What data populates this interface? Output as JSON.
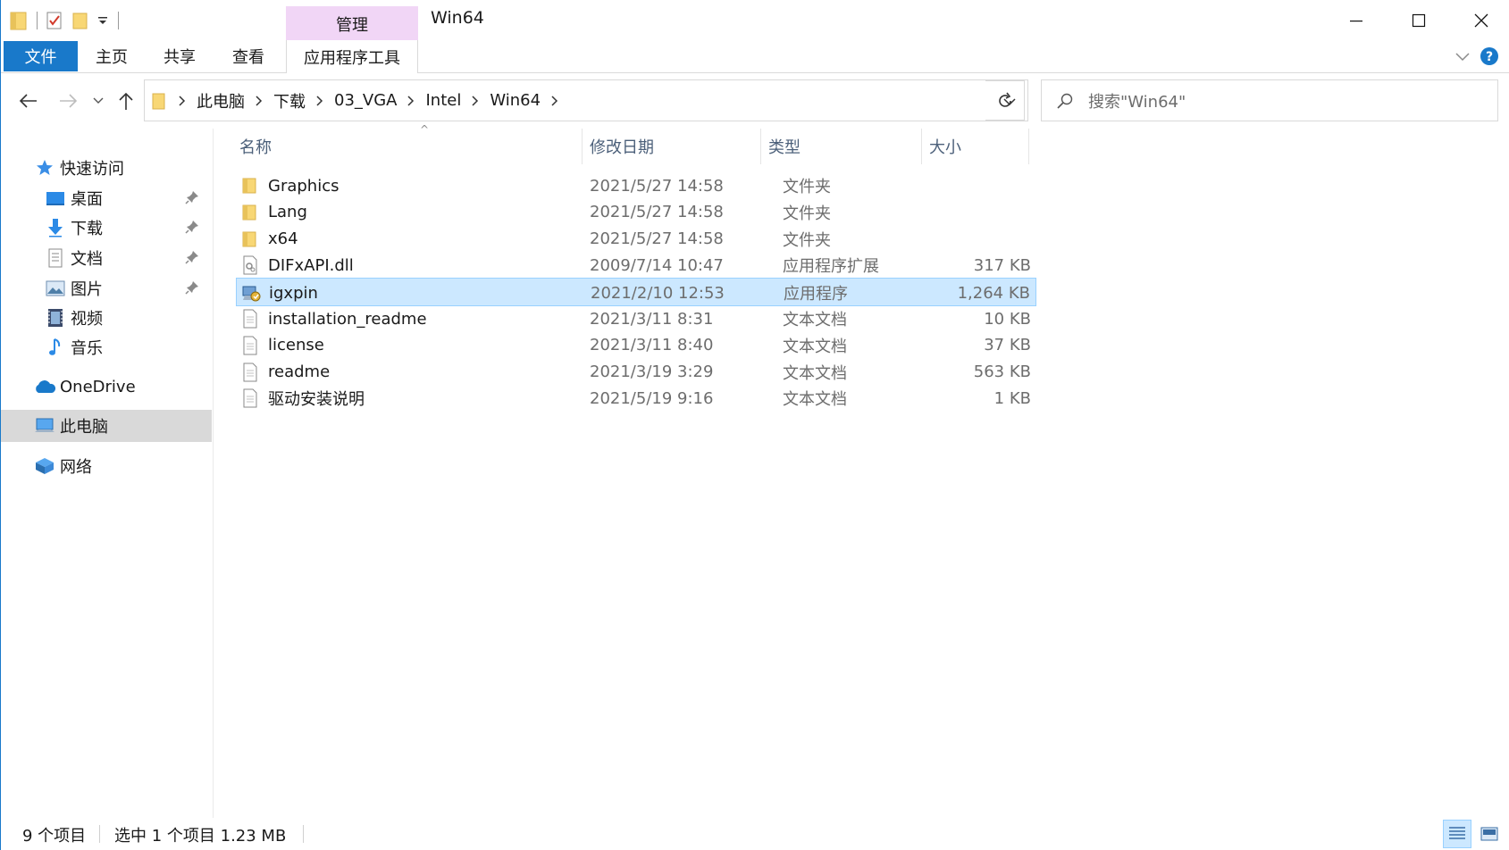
{
  "window": {
    "title": "Win64",
    "manage_tab": "管理"
  },
  "ribbon": {
    "tabs": [
      {
        "label": "文件"
      },
      {
        "label": "主页"
      },
      {
        "label": "共享"
      },
      {
        "label": "查看"
      },
      {
        "label": "应用程序工具"
      }
    ]
  },
  "address": {
    "crumbs": [
      "此电脑",
      "下载",
      "03_VGA",
      "Intel",
      "Win64"
    ]
  },
  "search": {
    "placeholder": "搜索\"Win64\""
  },
  "nav": {
    "quick_access": "快速访问",
    "items": [
      {
        "label": "桌面",
        "icon": "desktop-icon"
      },
      {
        "label": "下载",
        "icon": "download-icon"
      },
      {
        "label": "文档",
        "icon": "documents-icon"
      },
      {
        "label": "图片",
        "icon": "pictures-icon"
      },
      {
        "label": "视频",
        "icon": "videos-icon"
      },
      {
        "label": "音乐",
        "icon": "music-icon"
      }
    ],
    "onedrive": "OneDrive",
    "this_pc": "此电脑",
    "network": "网络"
  },
  "columns": {
    "name": "名称",
    "date": "修改日期",
    "type": "类型",
    "size": "大小"
  },
  "files": [
    {
      "name": "Graphics",
      "date": "2021/5/27 14:58",
      "type": "文件夹",
      "size": "",
      "icon": "folder-icon"
    },
    {
      "name": "Lang",
      "date": "2021/5/27 14:58",
      "type": "文件夹",
      "size": "",
      "icon": "folder-icon"
    },
    {
      "name": "x64",
      "date": "2021/5/27 14:58",
      "type": "文件夹",
      "size": "",
      "icon": "folder-icon"
    },
    {
      "name": "DIFxAPI.dll",
      "date": "2009/7/14 10:47",
      "type": "应用程序扩展",
      "size": "317 KB",
      "icon": "dll-file-icon"
    },
    {
      "name": "igxpin",
      "date": "2021/2/10 12:53",
      "type": "应用程序",
      "size": "1,264 KB",
      "icon": "installer-exe-icon"
    },
    {
      "name": "installation_readme",
      "date": "2021/3/11 8:31",
      "type": "文本文档",
      "size": "10 KB",
      "icon": "text-file-icon"
    },
    {
      "name": "license",
      "date": "2021/3/11 8:40",
      "type": "文本文档",
      "size": "37 KB",
      "icon": "text-file-icon"
    },
    {
      "name": "readme",
      "date": "2021/3/19 3:29",
      "type": "文本文档",
      "size": "563 KB",
      "icon": "text-file-icon"
    },
    {
      "name": "驱动安装说明",
      "date": "2021/5/19 9:16",
      "type": "文本文档",
      "size": "1 KB",
      "icon": "text-file-icon"
    }
  ],
  "selected_index": 4,
  "status": {
    "count": "9 个项目",
    "selection": "选中 1 个项目  1.23 MB"
  },
  "colors": {
    "accent": "#1979ca",
    "manage_tab": "#f1d6f6",
    "selection": "#cce8ff",
    "selection_border": "#99d1ff",
    "folder": "#f8d775"
  }
}
